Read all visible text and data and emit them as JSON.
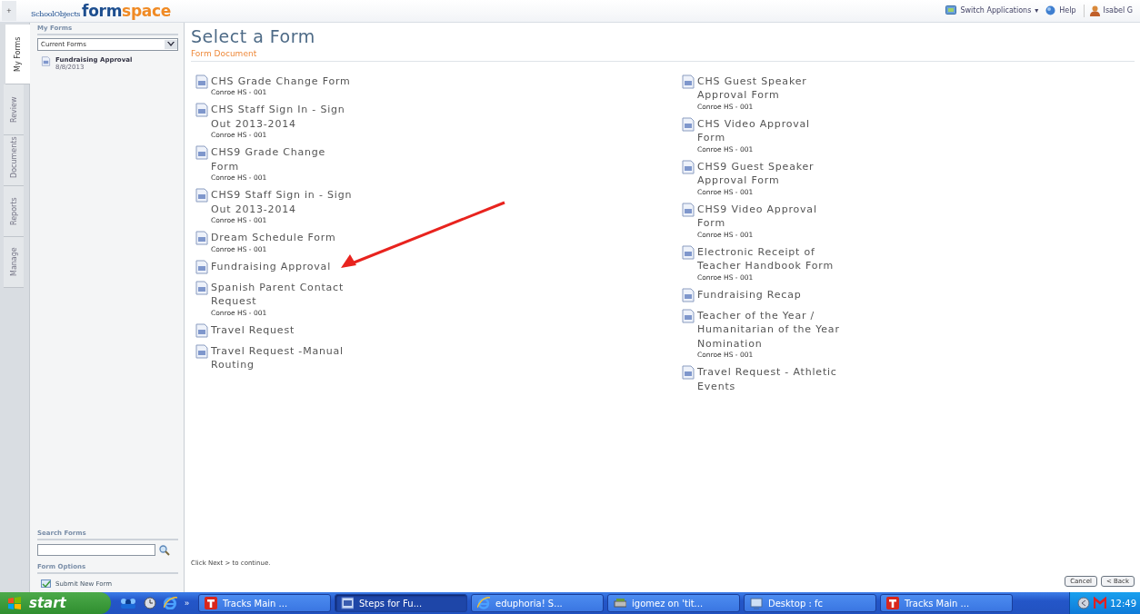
{
  "topbar": {
    "expand_button": "+",
    "logo": {
      "brand": "SchoolObjects",
      "product_first": "form",
      "product_second": "space"
    },
    "links": [
      {
        "kind": "apps",
        "label": "Switch Applications",
        "caret": "▾"
      },
      {
        "kind": "help",
        "label": "Help"
      },
      {
        "kind": "user",
        "label": "Isabel G"
      }
    ]
  },
  "side_tabs": [
    {
      "label": "My Forms",
      "selected": true
    },
    {
      "label": "Review",
      "selected": false
    },
    {
      "label": "Documents",
      "selected": false
    },
    {
      "label": "Reports",
      "selected": false
    },
    {
      "label": "Manage",
      "selected": false
    }
  ],
  "sidebar": {
    "heading": "My Forms",
    "filter": {
      "value": "Current Forms"
    },
    "items": [
      {
        "title": "Fundraising Approval",
        "date": "8/8/2013"
      }
    ],
    "search_heading": "Search Forms",
    "options_heading": "Form Options",
    "options": [
      {
        "label": "Submit New Form"
      }
    ]
  },
  "main": {
    "title": "Select a Form",
    "section": "Form Document",
    "columns": [
      [
        {
          "title": "CHS Grade Change Form",
          "subtitle": "Conroe HS - 001"
        },
        {
          "title": "CHS Staff Sign In - Sign Out 2013-2014",
          "subtitle": "Conroe HS - 001"
        },
        {
          "title": "CHS9 Grade Change Form",
          "subtitle": "Conroe HS - 001"
        },
        {
          "title": "CHS9 Staff Sign in - Sign Out 2013-2014",
          "subtitle": "Conroe HS - 001"
        },
        {
          "title": "Dream Schedule Form",
          "subtitle": "Conroe HS - 001"
        },
        {
          "title": "Fundraising Approval"
        },
        {
          "title": "Spanish Parent Contact Request",
          "subtitle": "Conroe HS - 001"
        },
        {
          "title": "Travel Request"
        },
        {
          "title": "Travel Request -Manual Routing"
        }
      ],
      [
        {
          "title": "CHS Guest Speaker Approval Form",
          "subtitle": "Conroe HS - 001"
        },
        {
          "title": "CHS Video Approval Form",
          "subtitle": "Conroe HS - 001"
        },
        {
          "title": "CHS9 Guest Speaker Approval Form",
          "subtitle": "Conroe HS - 001"
        },
        {
          "title": "CHS9 Video Approval Form",
          "subtitle": "Conroe HS - 001"
        },
        {
          "title": "Electronic Receipt of Teacher Handbook Form",
          "subtitle": "Conroe HS - 001"
        },
        {
          "title": "Fundraising Recap"
        },
        {
          "title": "Teacher of the Year / Humanitarian of the Year Nomination",
          "subtitle": "Conroe HS - 001"
        },
        {
          "title": "Travel Request - Athletic Events"
        }
      ]
    ],
    "hint": "Click Next > to continue.",
    "buttons": [
      "Cancel",
      "< Back"
    ]
  },
  "taskbar": {
    "start": "start",
    "more": "»",
    "tasks": [
      {
        "label": "Tracks Main ...",
        "kind": "tracks",
        "selected": false
      },
      {
        "label": "Steps for Fu...",
        "kind": "doc",
        "selected": true
      },
      {
        "label": "eduphoria! S...",
        "kind": "browser",
        "selected": false
      },
      {
        "label": "igomez on 'tit...",
        "kind": "drive",
        "selected": false
      },
      {
        "label": "Desktop : fc",
        "kind": "remote",
        "selected": false
      },
      {
        "label": "Tracks Main ...",
        "kind": "tracks",
        "selected": false
      }
    ],
    "clock": "12:49"
  }
}
